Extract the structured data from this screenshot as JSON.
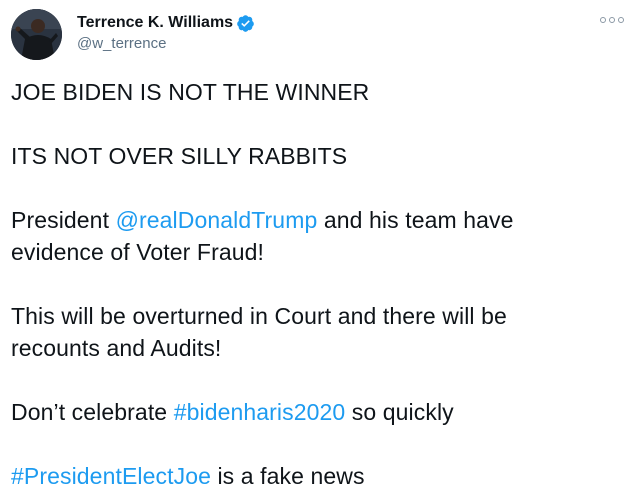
{
  "author": {
    "display_name": "Terrence K. Williams",
    "handle": "@w_terrence",
    "verified": true,
    "avatar_icon": "profile-photo",
    "verified_icon": "verified-badge-icon",
    "verified_color": "#1d9bf0"
  },
  "menu": {
    "icon": "more-options-icon"
  },
  "tweet": {
    "p1": "JOE BIDEN IS NOT THE WINNER",
    "p2": "ITS NOT OVER SILLY RABBITS",
    "p3_prefix": "President ",
    "p3_mention": "@realDonaldTrump",
    "p3_suffix": " and his team have",
    "p3_line2": "evidence of Voter Fraud!",
    "p4_line1": "This will be overturned in Court and there will be",
    "p4_line2": "recounts and Audits!",
    "p5_prefix": "Don’t celebrate ",
    "p5_hashtag": "#bidenharis2020",
    "p5_suffix": " so quickly",
    "p6_hashtag": "#PresidentElectJoe",
    "p6_suffix": " is a fake news"
  },
  "colors": {
    "text": "#0f1419",
    "secondary": "#5b7083",
    "link": "#1d9bf0",
    "background": "#ffffff"
  }
}
